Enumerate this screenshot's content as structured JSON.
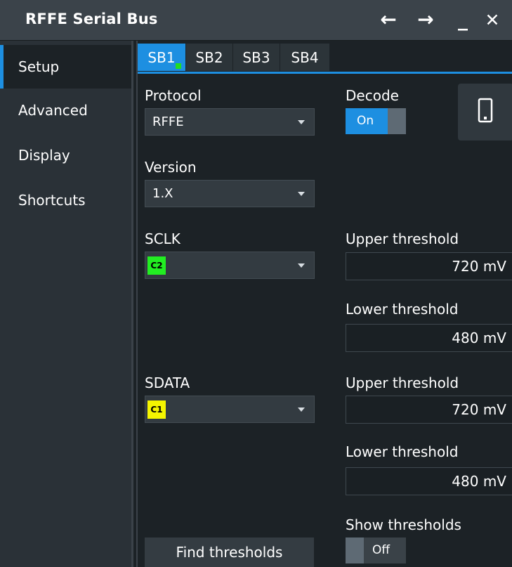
{
  "window": {
    "title": "RFFE Serial Bus"
  },
  "title_buttons": [
    {
      "name": "back-arrow-icon",
      "glyph": "←"
    },
    {
      "name": "forward-arrow-icon",
      "glyph": "→"
    },
    {
      "name": "minimize-icon",
      "glyph": "_"
    },
    {
      "name": "close-icon",
      "glyph": "✕"
    }
  ],
  "sidebar": {
    "items": [
      {
        "label": "Setup",
        "active": true
      },
      {
        "label": "Advanced"
      },
      {
        "label": "Display"
      },
      {
        "label": "Shortcuts"
      }
    ]
  },
  "tabs": [
    {
      "label": "SB1",
      "active": true
    },
    {
      "label": "SB2"
    },
    {
      "label": "SB3"
    },
    {
      "label": "SB4"
    }
  ],
  "protocol": {
    "label": "Protocol",
    "value": "RFFE"
  },
  "decode": {
    "label": "Decode",
    "state": "On"
  },
  "version": {
    "label": "Version",
    "value": "1.X"
  },
  "device_icon": "mobile-phone-icon",
  "sclk": {
    "label": "SCLK",
    "source": "C2",
    "source_color": "#22ee22",
    "upper_label": "Upper threshold",
    "upper_value": "720 mV",
    "lower_label": "Lower threshold",
    "lower_value": "480 mV"
  },
  "sdata": {
    "label": "SDATA",
    "source": "C1",
    "source_color": "#f5f500",
    "upper_label": "Upper threshold",
    "upper_value": "720 mV",
    "lower_label": "Lower threshold",
    "lower_value": "480 mV"
  },
  "show_thresholds": {
    "label": "Show thresholds",
    "state": "Off"
  },
  "find_thresholds": {
    "label": "Find thresholds"
  },
  "colors": {
    "accent": "#1d8fe1",
    "background": "#1c2226",
    "sidebar": "#2a3137"
  }
}
